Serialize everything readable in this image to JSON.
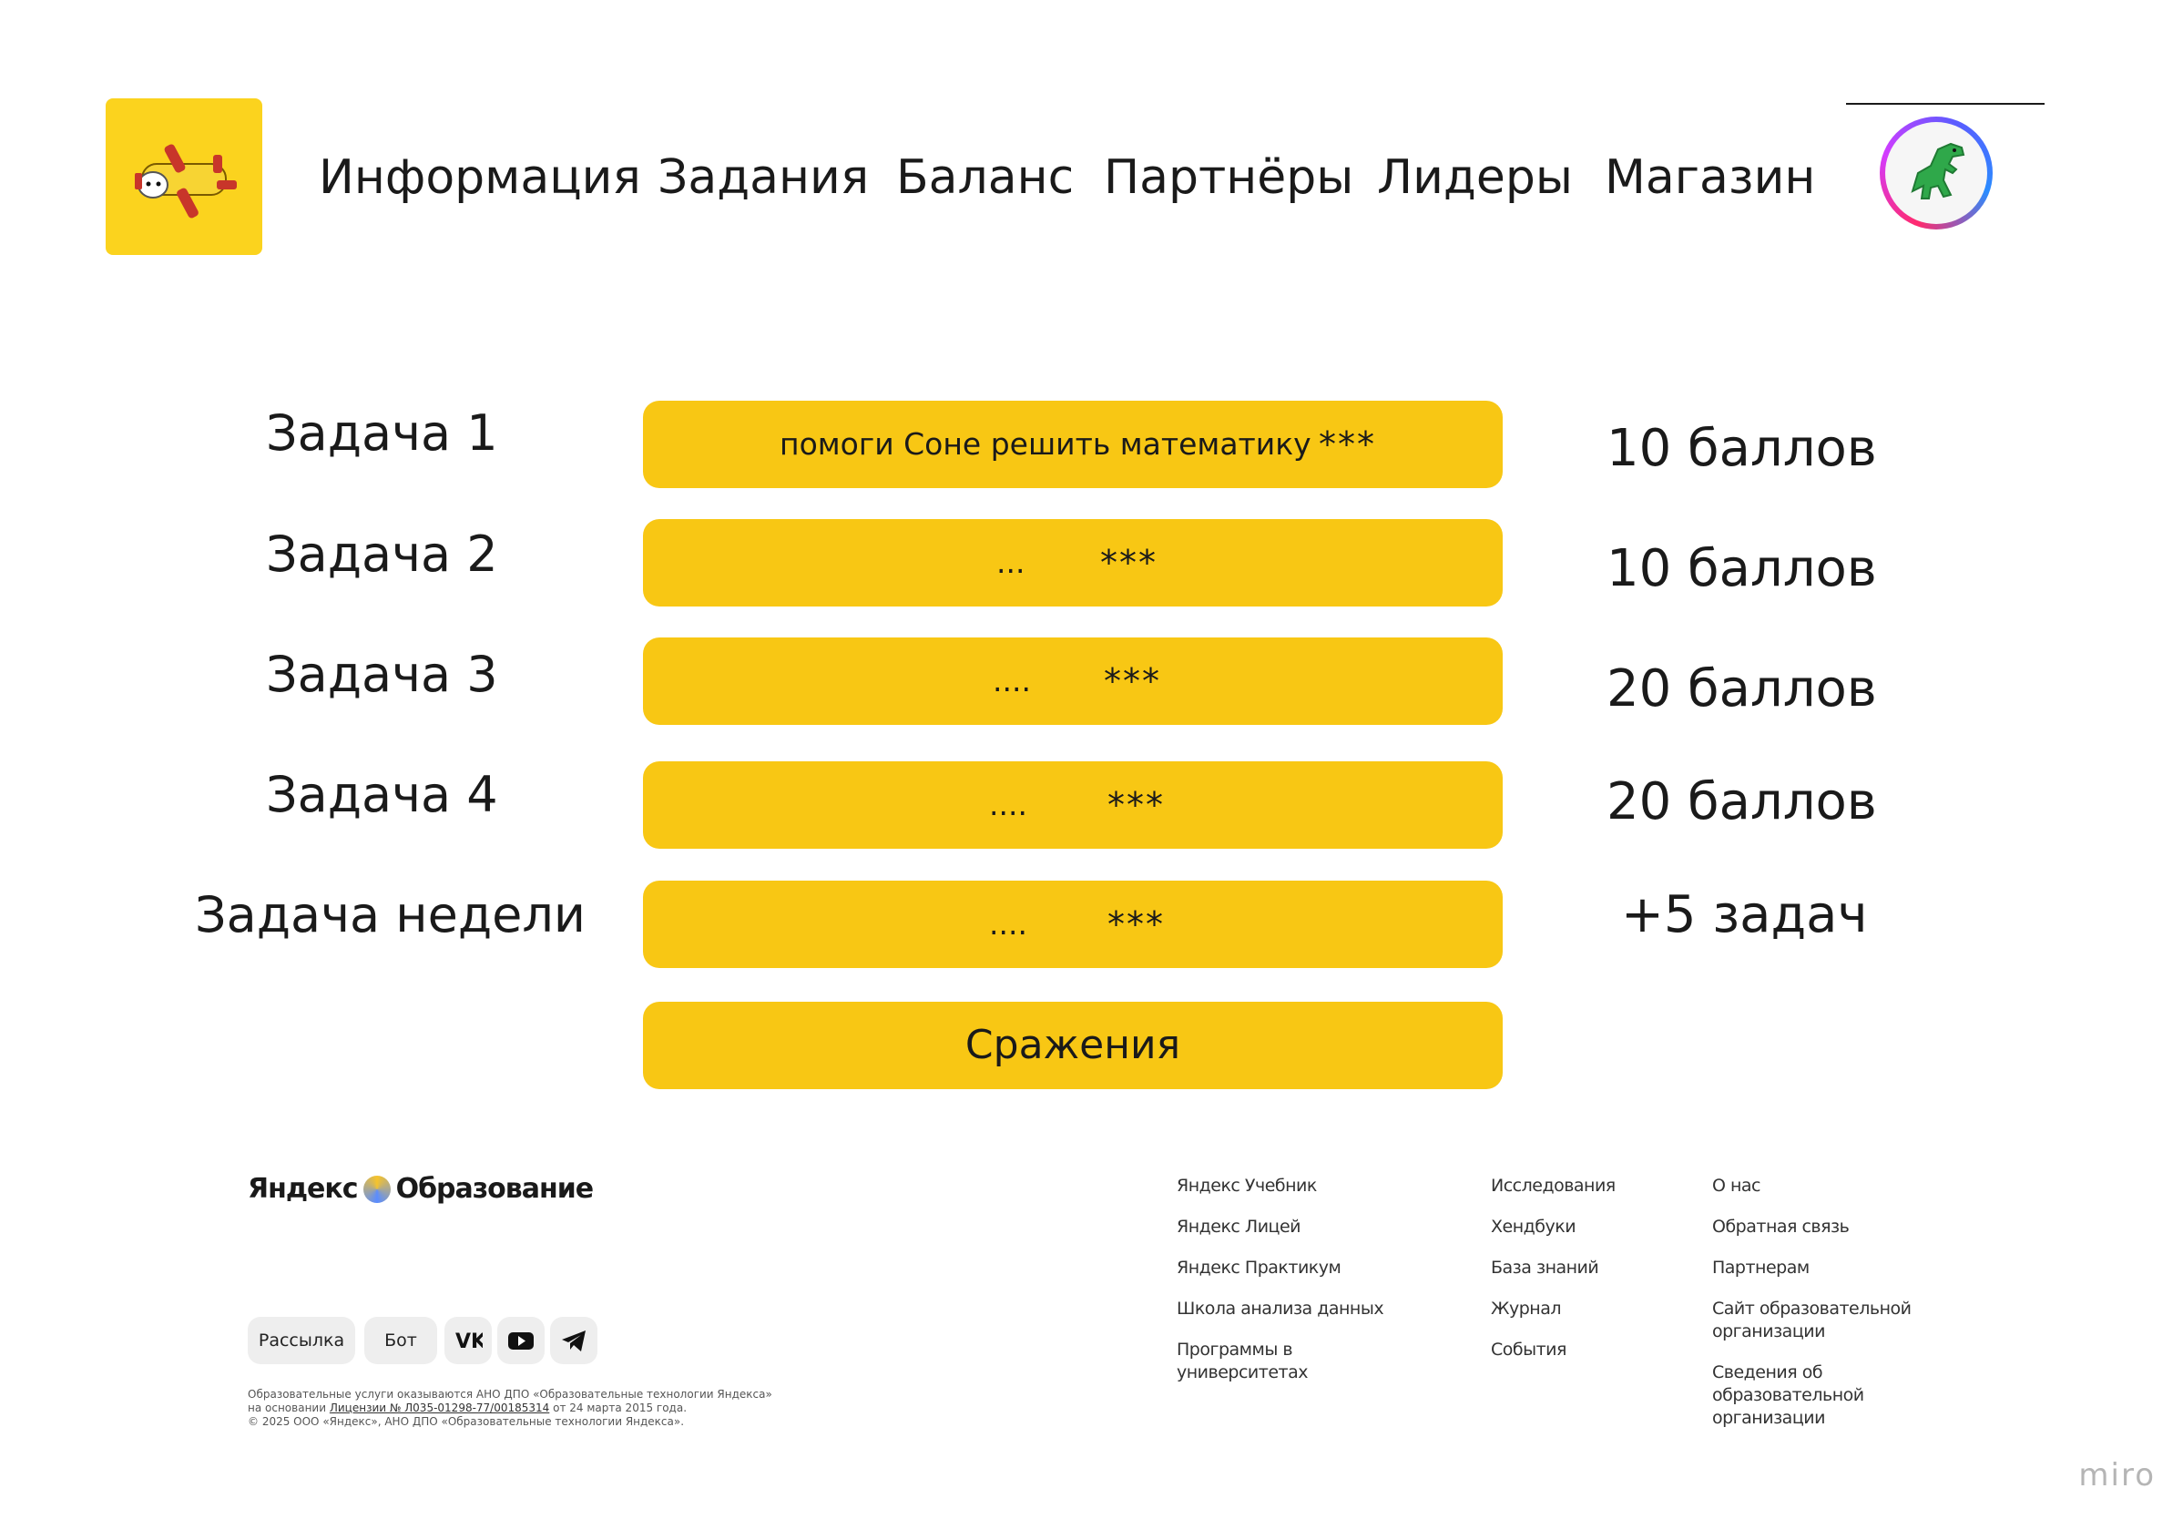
{
  "header": {
    "nav": [
      {
        "label": "Информация"
      },
      {
        "label": "Задания"
      },
      {
        "label": "Баланс"
      },
      {
        "label": "Партнёры"
      },
      {
        "label": "Лидеры"
      },
      {
        "label": "Магазин"
      }
    ],
    "logo_icon": "plane-toy-icon",
    "avatar_icon": "dinosaur-icon"
  },
  "tasks": [
    {
      "label": "Задача 1",
      "text": "помоги Соне решить математику",
      "stars": "***",
      "reward": "10 баллов"
    },
    {
      "label": "Задача 2",
      "text": "...",
      "stars": "***",
      "reward": "10 баллов"
    },
    {
      "label": "Задача 3",
      "text": "....",
      "stars": "***",
      "reward": "20 баллов"
    },
    {
      "label": "Задача 4",
      "text": "....",
      "stars": "***",
      "reward": "20 баллов"
    },
    {
      "label": "Задача недели",
      "text": "....",
      "stars": "***",
      "reward": "+5 задач"
    }
  ],
  "battle_button": "Сражения",
  "footer": {
    "brand_left": "Яндекс",
    "brand_right": "Образование",
    "pills": [
      "Рассылка",
      "Бот"
    ],
    "social_icons": [
      "vk-icon",
      "youtube-icon",
      "telegram-icon"
    ],
    "legal": {
      "line1": "Образовательные услуги оказываются АНО ДПО «Образовательные технологии Яндекса»",
      "line2_prefix": "на основании",
      "line2_link": "Лицензии № Л035-01298-77/00185314",
      "line2_suffix": "от 24 марта 2015 года.",
      "line3": "© 2025 ООО «Яндекс», АНО ДПО «Образовательные технологии Яндекса»."
    },
    "col1": [
      "Яндекс Учебник",
      "Яндекс Лицей",
      "Яндекс Практикум",
      "Школа анализа данных",
      "Программы в университетах"
    ],
    "col2": [
      "Исследования",
      "Хендбуки",
      "База знаний",
      "Журнал",
      "События"
    ],
    "col3": [
      "О нас",
      "Обратная связь",
      "Партнерам",
      "Сайт образовательной организации",
      "Сведения об образовательной организации"
    ]
  },
  "watermark": "miro",
  "colors": {
    "accent_yellow": "#F8C714",
    "logo_yellow": "#FBD31E"
  }
}
